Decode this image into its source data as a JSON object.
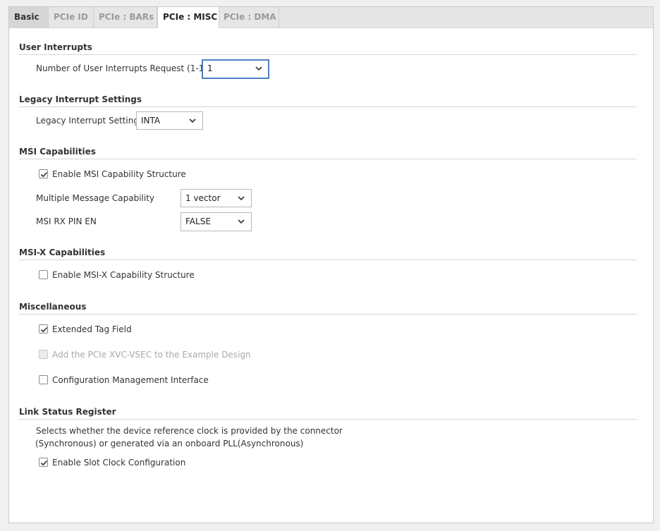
{
  "tabs": [
    {
      "label": "Basic"
    },
    {
      "label": "PCIe ID"
    },
    {
      "label": "PCIe : BARs"
    },
    {
      "label": "PCIe : MISC"
    },
    {
      "label": "PCIe : DMA"
    }
  ],
  "user_interrupts": {
    "title": "User Interrupts",
    "request_label": "Number of User Interrupts Request (1-16)",
    "request_value": "1"
  },
  "legacy": {
    "title": "Legacy Interrupt Settings",
    "settings_label": "Legacy Interrupt Settings",
    "settings_value": "INTA"
  },
  "msi": {
    "title": "MSI Capabilities",
    "enable_label": "Enable MSI Capability Structure",
    "enable_checked": true,
    "multiple_label": "Multiple Message Capability",
    "multiple_value": "1 vector",
    "rx_pin_label": "MSI RX PIN EN",
    "rx_pin_value": "FALSE"
  },
  "msix": {
    "title": "MSI-X Capabilities",
    "enable_label": "Enable MSI-X Capability Structure",
    "enable_checked": false
  },
  "misc": {
    "title": "Miscellaneous",
    "extended_tag_label": "Extended Tag Field",
    "extended_tag_checked": true,
    "xvc_label": "Add the PCIe XVC-VSEC to the Example Design",
    "xvc_checked": false,
    "xvc_disabled": true,
    "cfg_mgmt_label": "Configuration Management Interface",
    "cfg_mgmt_checked": false
  },
  "link_status": {
    "title": "Link Status Register",
    "desc_line1": "Selects whether the device reference clock is provided by the connector",
    "desc_line2": "(Synchronous) or generated via an onboard PLL(Asynchronous)",
    "slot_clock_label": "Enable Slot Clock Configuration",
    "slot_clock_checked": true
  },
  "icons": {
    "dropdown": "chevron-down-icon",
    "check": "checkmark-icon"
  },
  "colors": {
    "focus_border": "#4f7fbf",
    "disabled_text": "#a9a9a9"
  }
}
